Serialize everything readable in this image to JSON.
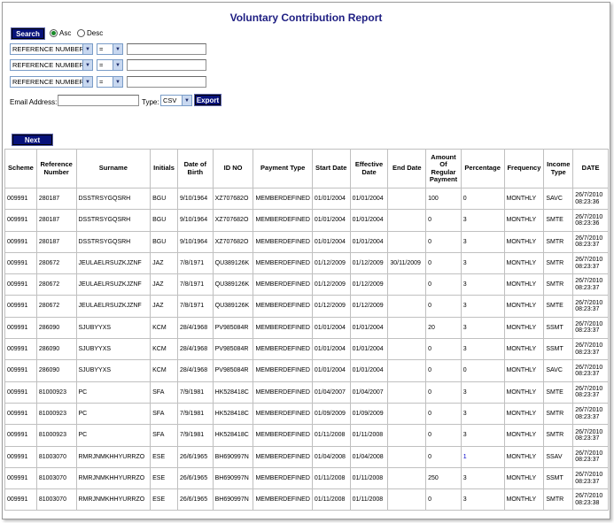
{
  "report": {
    "title": "Voluntary Contribution Report"
  },
  "controls": {
    "search_label": "Search",
    "sort_asc_label": "Asc",
    "sort_desc_label": "Desc",
    "sort_selected": "asc",
    "filters": [
      {
        "field": "REFERENCE NUMBER",
        "operator": "=",
        "value": ""
      },
      {
        "field": "REFERENCE NUMBER",
        "operator": "=",
        "value": ""
      },
      {
        "field": "REFERENCE NUMBER",
        "operator": "=",
        "value": ""
      }
    ],
    "email_label": "Email Address:",
    "email_value": "",
    "type_label": "Type:",
    "type_value": "CSV",
    "export_label": "Export",
    "next_label": "Next"
  },
  "table": {
    "headers": [
      "Scheme",
      "Reference Number",
      "Surname",
      "Initials",
      "Date of Birth",
      "ID NO",
      "Payment Type",
      "Start Date",
      "Effective Date",
      "End Date",
      "Amount Of Regular Payment",
      "Percentage",
      "Frequency",
      "Income Type",
      "DATE"
    ],
    "rows": [
      [
        "009991",
        "280187",
        "DSSTRSYGQSRH",
        "BGU",
        "9/10/1964",
        "XZ707682O",
        "MEMBERDEFINED",
        "01/01/2004",
        "01/01/2004",
        "",
        "100",
        "0",
        "MONTHLY",
        "SAVC",
        "26/7/2010 08:23:36"
      ],
      [
        "009991",
        "280187",
        "DSSTRSYGQSRH",
        "BGU",
        "9/10/1964",
        "XZ707682O",
        "MEMBERDEFINED",
        "01/01/2004",
        "01/01/2004",
        "",
        "0",
        "3",
        "MONTHLY",
        "SMTE",
        "26/7/2010 08:23:36"
      ],
      [
        "009991",
        "280187",
        "DSSTRSYGQSRH",
        "BGU",
        "9/10/1964",
        "XZ707682O",
        "MEMBERDEFINED",
        "01/01/2004",
        "01/01/2004",
        "",
        "0",
        "3",
        "MONTHLY",
        "SMTR",
        "26/7/2010 08:23:37"
      ],
      [
        "009991",
        "280672",
        "JEULAELRSUZKJZNF",
        "JAZ",
        "7/8/1971",
        "QU389126K",
        "MEMBERDEFINED",
        "01/12/2009",
        "01/12/2009",
        "30/11/2009",
        "0",
        "3",
        "MONTHLY",
        "SMTR",
        "26/7/2010 08:23:37"
      ],
      [
        "009991",
        "280672",
        "JEULAELRSUZKJZNF",
        "JAZ",
        "7/8/1971",
        "QU389126K",
        "MEMBERDEFINED",
        "01/12/2009",
        "01/12/2009",
        "",
        "0",
        "3",
        "MONTHLY",
        "SMTR",
        "26/7/2010 08:23:37"
      ],
      [
        "009991",
        "280672",
        "JEULAELRSUZKJZNF",
        "JAZ",
        "7/8/1971",
        "QU389126K",
        "MEMBERDEFINED",
        "01/12/2009",
        "01/12/2009",
        "",
        "0",
        "3",
        "MONTHLY",
        "SMTE",
        "26/7/2010 08:23:37"
      ],
      [
        "009991",
        "286090",
        "SJUBYYXS",
        "KCM",
        "28/4/1968",
        "PV985084R",
        "MEMBERDEFINED",
        "01/01/2004",
        "01/01/2004",
        "",
        "20",
        "3",
        "MONTHLY",
        "SSMT",
        "26/7/2010 08:23:37"
      ],
      [
        "009991",
        "286090",
        "SJUBYYXS",
        "KCM",
        "28/4/1968",
        "PV985084R",
        "MEMBERDEFINED",
        "01/01/2004",
        "01/01/2004",
        "",
        "0",
        "3",
        "MONTHLY",
        "SSMT",
        "26/7/2010 08:23:37"
      ],
      [
        "009991",
        "286090",
        "SJUBYYXS",
        "KCM",
        "28/4/1968",
        "PV985084R",
        "MEMBERDEFINED",
        "01/01/2004",
        "01/01/2004",
        "",
        "0",
        "0",
        "MONTHLY",
        "SAVC",
        "26/7/2010 08:23:37"
      ],
      [
        "009991",
        "81000923",
        "PC",
        "SFA",
        "7/9/1981",
        "HK528418C",
        "MEMBERDEFINED",
        "01/04/2007",
        "01/04/2007",
        "",
        "0",
        "3",
        "MONTHLY",
        "SMTE",
        "26/7/2010 08:23:37"
      ],
      [
        "009991",
        "81000923",
        "PC",
        "SFA",
        "7/9/1981",
        "HK528418C",
        "MEMBERDEFINED",
        "01/09/2009",
        "01/09/2009",
        "",
        "0",
        "3",
        "MONTHLY",
        "SMTR",
        "26/7/2010 08:23:37"
      ],
      [
        "009991",
        "81000923",
        "PC",
        "SFA",
        "7/9/1981",
        "HK528418C",
        "MEMBERDEFINED",
        "01/11/2008",
        "01/11/2008",
        "",
        "0",
        "3",
        "MONTHLY",
        "SMTR",
        "26/7/2010 08:23:37"
      ],
      [
        "009991",
        "81003070",
        "RMRJNMKHHYURRZO",
        "ESE",
        "26/6/1965",
        "BH690997N",
        "MEMBERDEFINED",
        "01/04/2008",
        "01/04/2008",
        "",
        "0",
        "1",
        "MONTHLY",
        "SSAV",
        "26/7/2010 08:23:37"
      ],
      [
        "009991",
        "81003070",
        "RMRJNMKHHYURRZO",
        "ESE",
        "26/6/1965",
        "BH690997N",
        "MEMBERDEFINED",
        "01/11/2008",
        "01/11/2008",
        "",
        "250",
        "3",
        "MONTHLY",
        "SSMT",
        "26/7/2010 08:23:37"
      ],
      [
        "009991",
        "81003070",
        "RMRJNMKHHYURRZO",
        "ESE",
        "26/6/1965",
        "BH690997N",
        "MEMBERDEFINED",
        "01/11/2008",
        "01/11/2008",
        "",
        "0",
        "3",
        "MONTHLY",
        "SMTR",
        "26/7/2010 08:23:38"
      ]
    ]
  },
  "colors": {
    "accent": "#07117a",
    "title": "#1e1e82",
    "highlight": "#0000cc"
  }
}
